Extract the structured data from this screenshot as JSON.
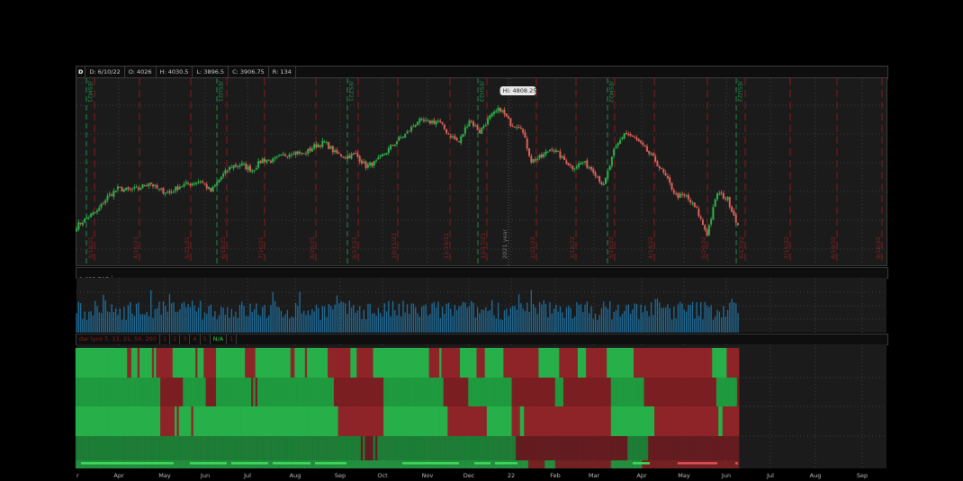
{
  "header": {
    "period": "D",
    "date": "D: 6/10/22",
    "open": "O: 4026",
    "high": "H: 4030.5",
    "low": "L: 3896.5",
    "close": "C: 3906.75",
    "range": "R: 134"
  },
  "tooltip": "Hi: 4808.25",
  "volume": {
    "label": "1,833,797"
  },
  "indicator": {
    "label": "dar lyns 5, 13, 21, 50, 200",
    "buttons": [
      "1",
      "2",
      "3",
      "4",
      "5",
      "N/A",
      "1"
    ]
  },
  "colors": {
    "up": "#2db34a",
    "down": "#e0605a",
    "volume": "#1f6f9e",
    "bg": "#1b1b1b",
    "expiry_line": "#1f8a4a",
    "event_line": "#8a1a1a"
  },
  "chart_data": {
    "type": "candlestick",
    "symbol_period": "daily",
    "price_range": [
      3605,
      5018
    ],
    "x_tick_labels": [
      "Apr",
      "May",
      "Jun",
      "Jul",
      "Aug",
      "Sep",
      "Oct",
      "Nov",
      "Dec",
      "22",
      "Feb",
      "Mar",
      "Apr",
      "May",
      "Jun",
      "Jul",
      "Aug",
      "Sep"
    ],
    "expiry_labels": [
      "/ESM21",
      "/ESU21",
      "/ESZ21",
      "/ESH22",
      "/ESM22",
      "/ESU22"
    ],
    "event_labels": [
      "3/19/21",
      "4/16/21",
      "5/21/21",
      "6/18/21",
      "7/16/21",
      "8/20/21",
      "9/17/21",
      "10/15/21",
      "11/19/21",
      "12/17/21",
      "2021 year",
      "1/21/22",
      "2/18/22",
      "3/18/22",
      "4/14/22",
      "5/20/22",
      "6/17/22",
      "7/15/22",
      "8/19/22",
      "9/16/22"
    ],
    "weekly_closes": [
      3900,
      3960,
      4010,
      4120,
      4180,
      4170,
      4180,
      4230,
      4170,
      4150,
      4200,
      4220,
      4240,
      4160,
      4270,
      4350,
      4360,
      4320,
      4400,
      4390,
      4430,
      4460,
      4440,
      4500,
      4530,
      4450,
      4420,
      4440,
      4350,
      4380,
      4460,
      4540,
      4600,
      4690,
      4680,
      4690,
      4590,
      4530,
      4700,
      4610,
      4720,
      4780,
      4670,
      4650,
      4390,
      4420,
      4490,
      4410,
      4340,
      4380,
      4320,
      4200,
      4460,
      4600,
      4560,
      4480,
      4390,
      4270,
      4130,
      4120,
      4020,
      3840,
      4150,
      4100,
      3906.75
    ],
    "high_marker": 4808.25,
    "last_close": 3906.75
  }
}
